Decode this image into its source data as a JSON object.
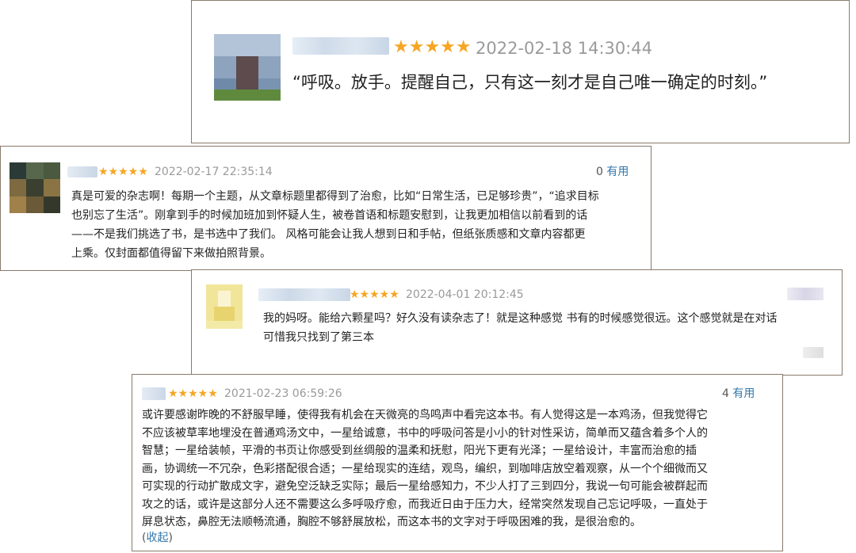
{
  "reviews": [
    {
      "stars": "★★★★★",
      "time": "2022-02-18 14:30:44",
      "text": "“呼吸。放手。提醒自己，只有这一刻才是自己唯一确定的时刻。”"
    },
    {
      "stars": "★★★★★",
      "time": "2022-02-17 22:35:14",
      "useful_count": "0",
      "useful_label": "有用",
      "lines": [
        "真是可爱的杂志啊！每期一个主题，从文章标题里都得到了治愈，比如“日常生活，已足够珍贵”，“追求目标",
        "也别忘了生活”。刚拿到手的时候加班加到怀疑人生，被卷首语和标题安慰到，让我更加相信以前看到的话",
        "——不是我们挑选了书，是书选中了我们。 风格可能会让我人想到日和手帖，但纸张质感和文章内容都更",
        "上乘。仅封面都值得留下来做拍照背景。"
      ]
    },
    {
      "stars": "★★★★★",
      "time": "2022-04-01 20:12:45",
      "lines": [
        "我的妈呀。能给六颗星吗？好久没有读杂志了！就是这种感觉 书有的时候感觉很远。这个感觉就是在对话",
        "可惜我只找到了第三本"
      ]
    },
    {
      "stars": "★★★★★",
      "time": "2021-02-23 06:59:26",
      "useful_count": "4",
      "useful_label": "有用",
      "lines": [
        "或许要感谢昨晚的不舒服早睡，使得我有机会在天微亮的鸟鸣声中看完这本书。有人觉得这是一本鸡汤，但我觉得它",
        "不应该被草率地埋没在普通鸡汤文中，一星给诚意，书中的呼吸问答是小小的针对性采访，简单而又蕴含着多个人的",
        "智慧；一星给装帧，平滑的书页让你感受到丝绸般的温柔和抚慰，阳光下更有光泽；一星给设计，丰富而治愈的插",
        "画，协调统一不冗杂，色彩搭配很合适；一星给现实的连结，观鸟，编织，到咖啡店放空着观察，从一个个细微而又",
        "可实现的行动扩散成文字，避免空泛缺乏实际；最后一星给感知力，不少人打了三到四分，我说一句可能会被群起而",
        "攻之的话，或许是这部分人还不需要这么多呼吸疗愈，而我近日由于压力大，经常突然发现自己忘记呼吸，一直处于",
        "屏息状态，鼻腔无法顺畅流通，胸腔不够舒展放松，而这本书的文字对于呼吸困难的我，是很治愈的。"
      ],
      "collapse_open": "(",
      "collapse_label": "收起",
      "collapse_close": ")"
    }
  ]
}
